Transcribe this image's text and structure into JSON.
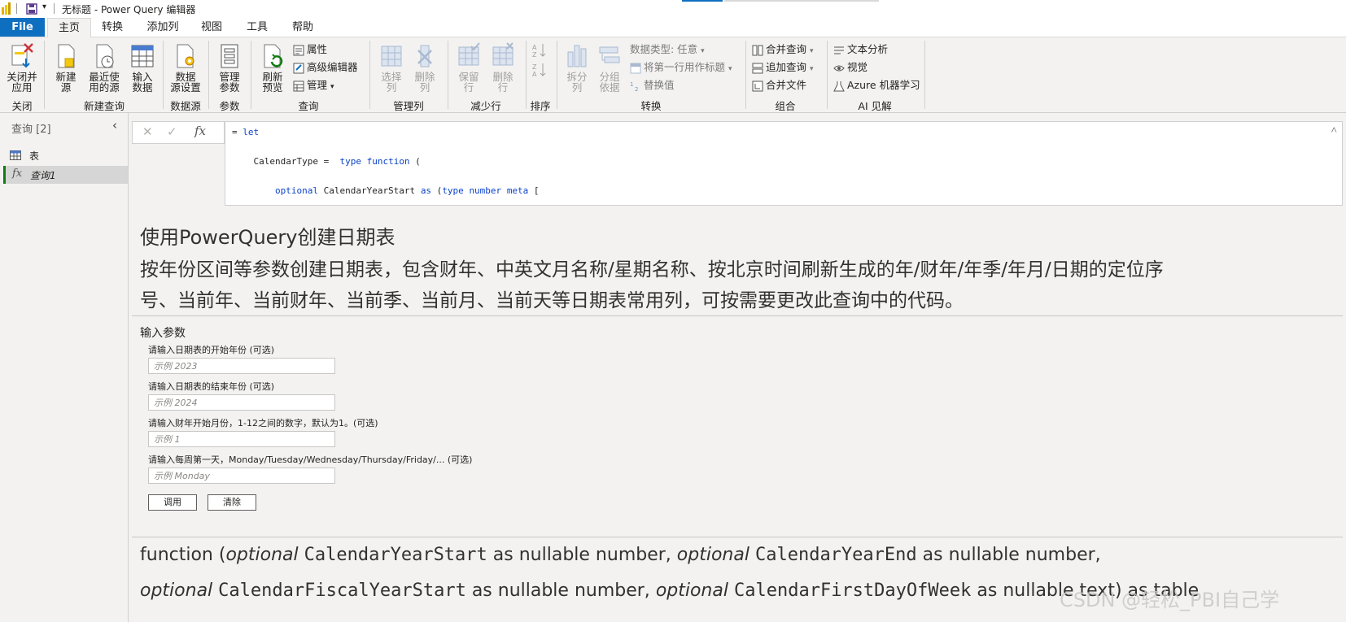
{
  "titlebar": {
    "title": "无标题 - Power Query 编辑器"
  },
  "tabs": [
    {
      "label": "File"
    },
    {
      "label": "主页"
    },
    {
      "label": "转换"
    },
    {
      "label": "添加列"
    },
    {
      "label": "视图"
    },
    {
      "label": "工具"
    },
    {
      "label": "帮助"
    }
  ],
  "ribbon": {
    "close_apply": "关闭并\n应用",
    "new_source": "新建\n源",
    "recent_sources": "最近使\n用的源",
    "enter_data": "输入\n数据",
    "data_source_settings": "数据\n源设置",
    "manage_params": "管理\n参数",
    "refresh_preview": "刷新\n预览",
    "properties": "属性",
    "advanced_editor": "高级编辑器",
    "manage": "管理",
    "choose_cols": "选择\n列",
    "remove_cols": "删除\n列",
    "keep_rows": "保留\n行",
    "remove_rows": "删除\n行",
    "split_col": "拆分\n列",
    "group_by": "分组\n依据",
    "data_type": "数据类型: 任意",
    "first_row_header": "将第一行用作标题",
    "replace_values": "替换值",
    "merge_queries": "合并查询",
    "append_queries": "追加查询",
    "combine_files": "合并文件",
    "text_analytics": "文本分析",
    "vision": "视觉",
    "azure_ml": "Azure 机器学习",
    "groups": {
      "close": "关闭",
      "new_query": "新建查询",
      "data_source": "数据源",
      "params": "参数",
      "query": "查询",
      "manage_cols": "管理列",
      "reduce_rows": "减少行",
      "sort": "排序",
      "transform": "转换",
      "combine": "组合",
      "ai": "AI 见解"
    }
  },
  "queries": {
    "header": "查询 [2]",
    "items": [
      {
        "label": "表"
      },
      {
        "label": "查询1"
      }
    ]
  },
  "formula": {
    "lines": [
      "= let",
      "    CalendarType =  type function (",
      "        optional CalendarYearStart as (type number meta ["
    ]
  },
  "content": {
    "title": "使用PowerQuery创建日期表",
    "desc1": "按年份区间等参数创建日期表，包含财年、中英文月名称/星期名称、按北京时间刷新生成的年/财年/年季/年月/日期的定位序",
    "desc2": "号、当前年、当前财年、当前季、当前月、当前天等日期表常用列，可按需要更改此查询中的代码。",
    "params_header": "输入参数",
    "params": [
      {
        "label": "请输入日期表的开始年份 (可选)",
        "placeholder": "示例 2023"
      },
      {
        "label": "请输入日期表的结束年份 (可选)",
        "placeholder": "示例 2024"
      },
      {
        "label": "请输入财年开始月份，1-12之间的数字，默认为1。(可选)",
        "placeholder": "示例 1"
      },
      {
        "label": "请输入每周第一天，Monday/Tuesday/Wednesday/Thursday/Friday/... (可选)",
        "placeholder": "示例 Monday"
      }
    ],
    "invoke": "调用",
    "clear": "清除",
    "sig": {
      "l1a": "function (",
      "opt": "optional",
      "p1": "CalendarYearStart",
      "t1": "as nullable number,",
      "p2": "CalendarYearEnd",
      "t2": "as nullable number,",
      "p3": "CalendarFiscalYearStart",
      "t3": "as nullable number,",
      "p4": "CalendarFirstDayOfWeek",
      "t4": "as nullable text) as table"
    }
  },
  "watermark": "CSDN @轻松_PBI自己学"
}
